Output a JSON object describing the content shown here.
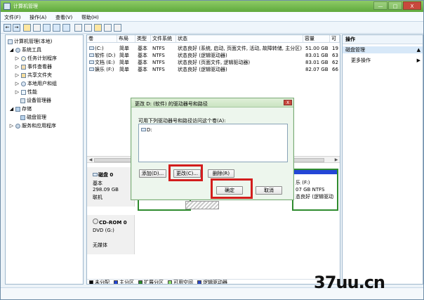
{
  "window": {
    "title": "计算机管理",
    "controls": [
      "—",
      "□",
      "X"
    ]
  },
  "menu": {
    "file": "文件(F)",
    "action": "操作(A)",
    "view": "查看(V)",
    "help": "帮助(H)"
  },
  "toolbar": {
    "back": "←",
    "forward": "→"
  },
  "tree": {
    "root": "计算机管理(本地)",
    "system_tools": "系统工具",
    "task_scheduler": "任务计划程序",
    "event_viewer": "事件查看器",
    "shared_folders": "共享文件夹",
    "local_users_groups": "本地用户和组",
    "performance": "性能",
    "device_manager": "设备管理器",
    "storage": "存储",
    "disk_management": "磁盘管理",
    "services_apps": "服务和应用程序"
  },
  "volumes": {
    "headers": [
      "卷",
      "布局",
      "类型",
      "文件系统",
      "状态",
      "容量",
      "可"
    ],
    "rows": [
      [
        "(C:)",
        "简单",
        "基本",
        "NTFS",
        "状态良好 (系统, 启动, 页面文件, 活动, 故障转储, 主分区)",
        "51.00 GB",
        "19"
      ],
      [
        "软件 (D:)",
        "简单",
        "基本",
        "NTFS",
        "状态良好 (逻辑驱动器)",
        "83.01 GB",
        "63"
      ],
      [
        "文档 (E:)",
        "简单",
        "基本",
        "NTFS",
        "状态良好 (页面文件, 逻辑驱动器)",
        "83.01 GB",
        "62"
      ],
      [
        "娱乐 (F:)",
        "简单",
        "基本",
        "NTFS",
        "状态良好 (逻辑驱动器)",
        "82.07 GB",
        "66"
      ]
    ]
  },
  "disk0": {
    "title": "磁盘 0",
    "type": "基本",
    "size": "298.09 GB",
    "status": "联机",
    "partition_label": "乐 (F:)",
    "partition_size": "07 GB NTFS",
    "partition_status": "态良好 (逻辑驱动"
  },
  "cdrom0": {
    "title": "CD-ROM 0",
    "drive": "DVD (G:)",
    "status": "无媒体"
  },
  "legend": {
    "items": [
      "未分配",
      "主分区",
      "扩展分区",
      "可用空间",
      "逻辑驱动器"
    ],
    "colors": [
      "#000000",
      "#2346d7",
      "#2f8b2f",
      "#8fe06b",
      "#2c47c5"
    ]
  },
  "operations": {
    "header": "操作",
    "selected": "磁盘管理",
    "more": "更多操作",
    "arrow": "▶"
  },
  "dialog": {
    "title": "更改 D: (软件) 的驱动器号和路径",
    "description": "可用下列驱动器号和路径访问这个卷(A):",
    "list_item": "D:",
    "close": "X",
    "buttons": {
      "add": "添加(D)...",
      "change": "更改(C)...",
      "remove": "删除(R)",
      "ok": "确定",
      "cancel": "取消"
    }
  },
  "watermark": "37uu.cn"
}
